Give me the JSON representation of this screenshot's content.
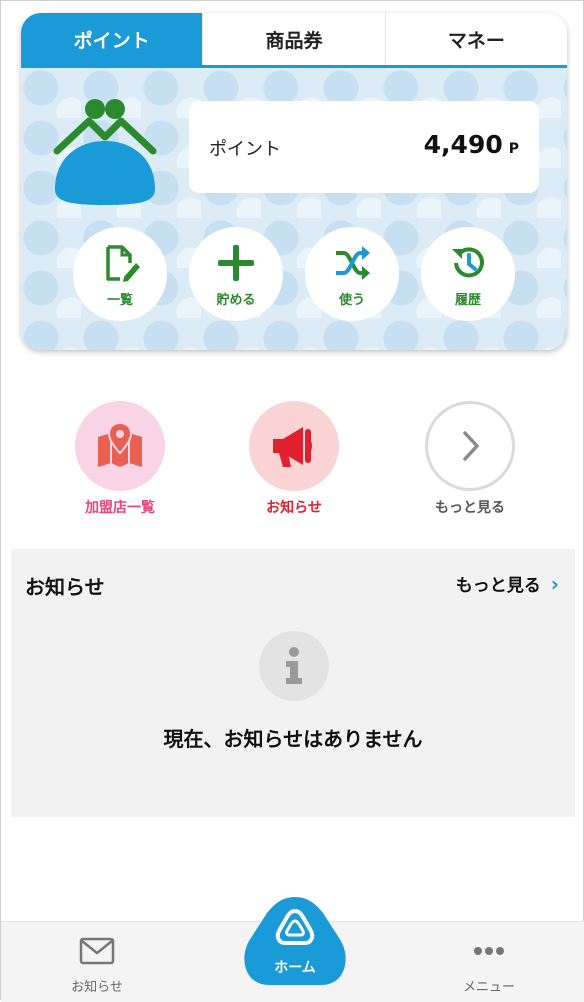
{
  "tabs": [
    {
      "label": "ポイント",
      "active": true
    },
    {
      "label": "商品券",
      "active": false
    },
    {
      "label": "マネー",
      "active": false
    }
  ],
  "point": {
    "label": "ポイント",
    "value": "4,490",
    "unit": "P"
  },
  "actions": [
    {
      "label": "一覧",
      "icon": "document-edit-icon"
    },
    {
      "label": "貯める",
      "icon": "plus-icon"
    },
    {
      "label": "使う",
      "icon": "shuffle-icon"
    },
    {
      "label": "履歴",
      "icon": "history-icon"
    }
  ],
  "quick_links": [
    {
      "label": "加盟店一覧",
      "icon": "map-pin-icon",
      "color": "#e8457f",
      "bg": "#f8d4e6"
    },
    {
      "label": "お知らせ",
      "icon": "megaphone-icon",
      "color": "#e0202e",
      "bg": "#fad4d4"
    },
    {
      "label": "もっと見る",
      "icon": "chevron-right-icon",
      "color": "#555555",
      "bg": "#ffffff"
    }
  ],
  "notice": {
    "title": "お知らせ",
    "more": "もっと見る",
    "empty": "現在、お知らせはありません"
  },
  "bottom_nav": {
    "left": {
      "label": "お知らせ",
      "icon": "mail-icon"
    },
    "center": {
      "label": "ホーム",
      "icon": "home-logo-icon"
    },
    "right": {
      "label": "メニュー",
      "icon": "more-dots-icon"
    }
  },
  "colors": {
    "primary": "#1a9ad6",
    "green": "#2b8a2e",
    "pink": "#e8457f",
    "red": "#e0202e"
  }
}
